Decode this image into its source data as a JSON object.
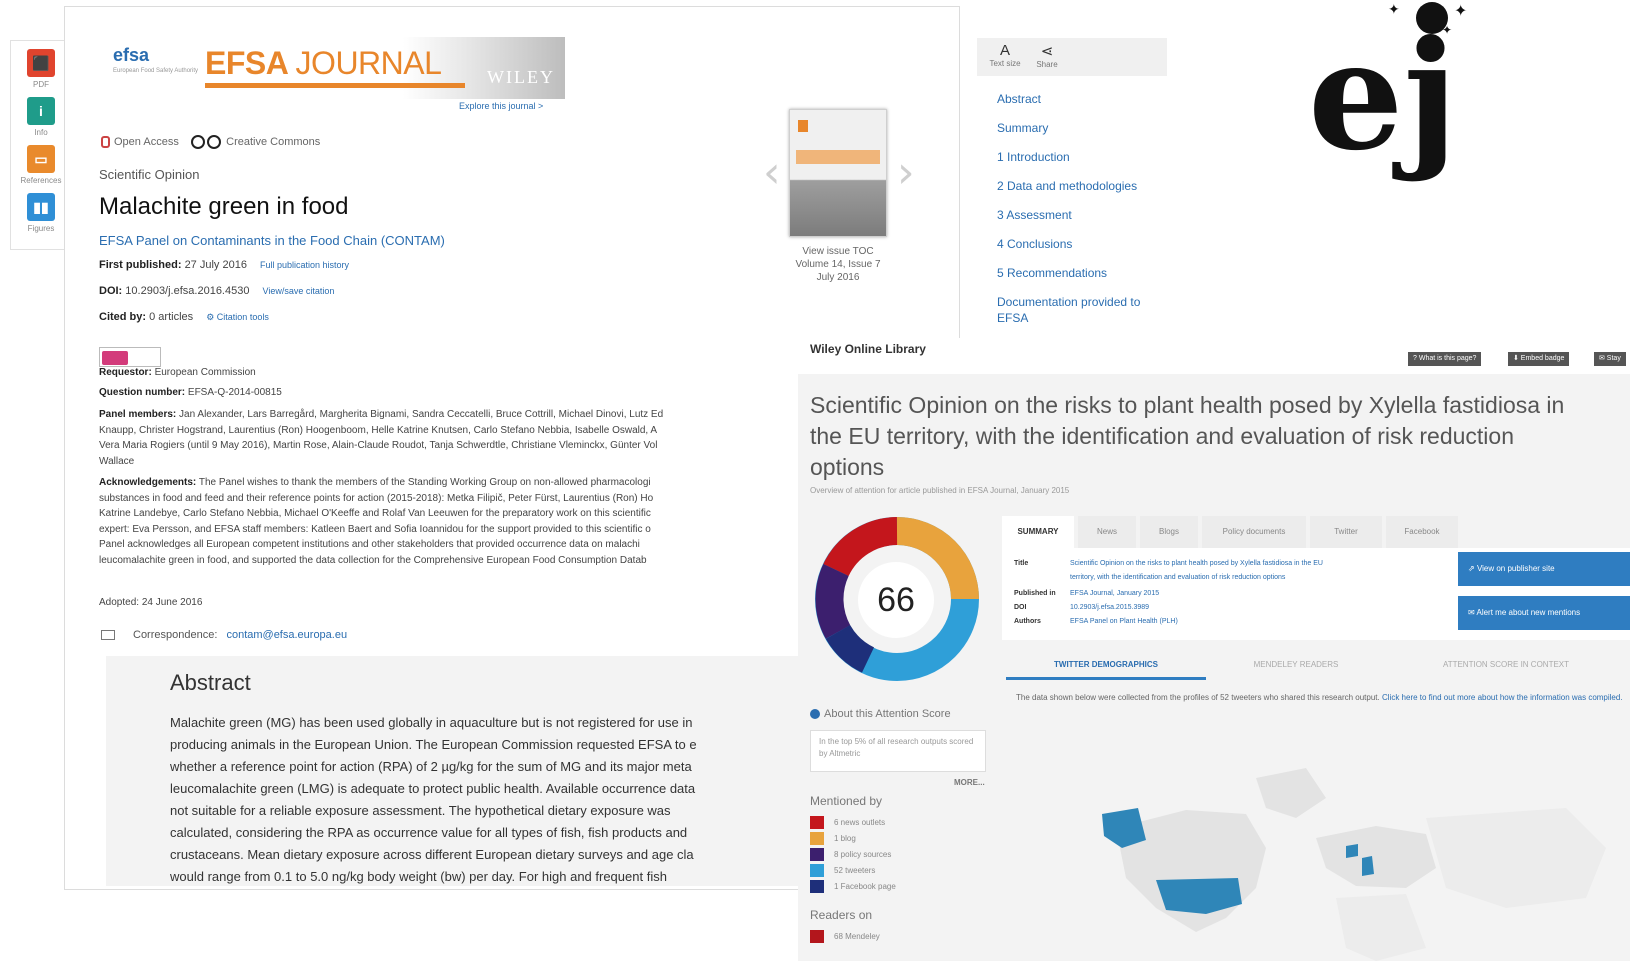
{
  "rail": [
    {
      "label": "PDF",
      "icon": "pdf-icon",
      "color": "#e0442e"
    },
    {
      "label": "Info",
      "icon": "info-icon",
      "color": "#1f9c8a"
    },
    {
      "label": "References",
      "icon": "references-icon",
      "color": "#e98a2c"
    },
    {
      "label": "Figures",
      "icon": "figures-icon",
      "color": "#2f8fd6"
    }
  ],
  "efsa": {
    "logo": "efsa",
    "logo_sub": "European Food Safety Authority",
    "journal_name_bold": "EFSA",
    "journal_name_thin": "JOURNAL",
    "publisher": "WILEY",
    "explore_link": "Explore this journal >",
    "open_access": "Open Access",
    "license": "Creative Commons",
    "article_type": "Scientific Opinion",
    "title": "Malachite green in food",
    "authors": "EFSA Panel on Contaminants in the Food Chain (CONTAM)",
    "first_published_label": "First published:",
    "first_published": "27 July 2016",
    "history_link": "Full publication history",
    "doi_label": "DOI:",
    "doi": "10.2903/j.efsa.2016.4530",
    "citation_link": "View/save citation",
    "cited_label": "Cited by:",
    "cited_value": "0 articles",
    "citation_tools": "Citation tools",
    "requestor_label": "Requestor:",
    "requestor": "European Commission",
    "question_label": "Question number:",
    "question": "EFSA-Q-2014-00815",
    "panel_label": "Panel members:",
    "panel_lines": [
      "Jan Alexander, Lars Barregård, Margherita Bignami, Sandra Ceccatelli, Bruce Cottrill, Michael Dinovi, Lutz Ed",
      "Knaupp, Christer Hogstrand, Laurentius (Ron) Hoogenboom, Helle Katrine Knutsen, Carlo Stefano Nebbia, Isabelle Oswald, A",
      "Vera Maria Rogiers (until 9 May 2016), Martin Rose, Alain-Claude Roudot, Tanja Schwerdtle, Christiane Vleminckx, Günter Vol",
      "Wallace"
    ],
    "ack_label": "Acknowledgements:",
    "ack_lines": [
      "The Panel wishes to thank the members of the Standing Working Group on non-allowed pharmacologi",
      "substances in food and feed and their reference points for action (2015-2018): Metka Filipič, Peter Fürst, Laurentius (Ron) Ho",
      "Katrine Landebye, Carlo Stefano Nebbia, Michael O'Keeffe and Rolaf Van Leeuwen for the preparatory work on this scientific",
      "expert: Eva Persson, and EFSA staff members: Katleen Baert and Sofia Ioannidou for the support provided to this scientific o",
      "Panel acknowledges all European competent institutions and other stakeholders that provided occurrence data on malachi",
      "leucomalachite green in food, and supported the data collection for the Comprehensive European Food Consumption Datab"
    ],
    "adopted": "Adopted: 24 June 2016",
    "correspondence_label": "Correspondence:",
    "correspondence": "contam@efsa.europa.eu",
    "abstract_heading": "Abstract",
    "abstract_lines": [
      "Malachite green (MG) has been used globally in aquaculture but is not registered for use in",
      "producing animals in the European Union. The European Commission requested EFSA to e",
      "whether a reference point for action (RPA) of 2 µg/kg for the sum of MG and its major meta",
      "leucomalachite green (LMG) is adequate to protect public health. Available occurrence data",
      "not suitable for a reliable exposure assessment. The hypothetical dietary exposure was",
      "calculated, considering the RPA as occurrence value for all types of fish, fish products and",
      "crustaceans. Mean dietary exposure across different European dietary surveys and age cla",
      "would range from 0.1 to 5.0 ng/kg body weight (bw) per day. For high and frequent fish"
    ],
    "issue_caption_1": "View issue TOC",
    "issue_caption_2": "Volume 14, Issue 7",
    "issue_caption_3": "July 2016"
  },
  "toc": {
    "tools": [
      {
        "label": "Text size",
        "glyph": "A"
      },
      {
        "label": "Share",
        "glyph": "⋖"
      }
    ],
    "items": [
      "Abstract",
      "Summary",
      "1 Introduction",
      "2 Data and methodologies",
      "3 Assessment",
      "4 Conclusions",
      "5 Recommendations",
      "Documentation provided to",
      "EFSA"
    ]
  },
  "ej_logo": "ej",
  "wiley": {
    "brand": "Wiley Online Library",
    "top_buttons": [
      "? What is this page?",
      "⬇ Embed badge",
      "✉ Stay"
    ],
    "title_lines": [
      "Scientific Opinion on the risks to plant health posed by Xylella fastidiosa in",
      "the EU territory, with the identification and evaluation of risk reduction",
      "options"
    ],
    "subtitle": "Overview of attention for article published in EFSA Journal, January 2015",
    "score": "66",
    "about": "About this Attention Score",
    "about_box": "In the top 5% of all research outputs scored by Altmetric",
    "more": "MORE...",
    "mentioned_by": "Mentioned by",
    "mentions": [
      {
        "label": "6 news outlets",
        "color": "#c4161c"
      },
      {
        "label": "1 blog",
        "color": "#e8a33d"
      },
      {
        "label": "8 policy sources",
        "color": "#3c1f6e"
      },
      {
        "label": "52 tweeters",
        "color": "#2f9fd8"
      },
      {
        "label": "1 Facebook page",
        "color": "#1e2f7a"
      }
    ],
    "readers_on": "Readers on",
    "readers": [
      {
        "label": "68 Mendeley",
        "color": "#b3161c"
      }
    ],
    "tabs": [
      "SUMMARY",
      "News",
      "Blogs",
      "Policy documents",
      "Twitter",
      "Facebook"
    ],
    "summary_rows": [
      {
        "label": "Title",
        "value": "Scientific Opinion on the risks to plant health posed by Xylella fastidiosa in the EU"
      },
      {
        "label": "",
        "value": "territory, with the identification and evaluation of risk reduction options"
      },
      {
        "label": "Published in",
        "value": "EFSA Journal, January 2015"
      },
      {
        "label": "DOI",
        "value": "10.2903/j.efsa.2015.3989"
      },
      {
        "label": "Authors",
        "value": "EFSA Panel on Plant Health (PLH)"
      }
    ],
    "action_buttons": [
      "View on publisher site",
      "Alert me about new mentions"
    ],
    "demo_tabs": [
      "TWITTER DEMOGRAPHICS",
      "MENDELEY READERS",
      "ATTENTION SCORE IN CONTEXT"
    ],
    "demo_text": "The data shown below were collected from the profiles of 52 tweeters who shared this research output.",
    "demo_link": "Click here to find out more about how the information was compiled."
  }
}
